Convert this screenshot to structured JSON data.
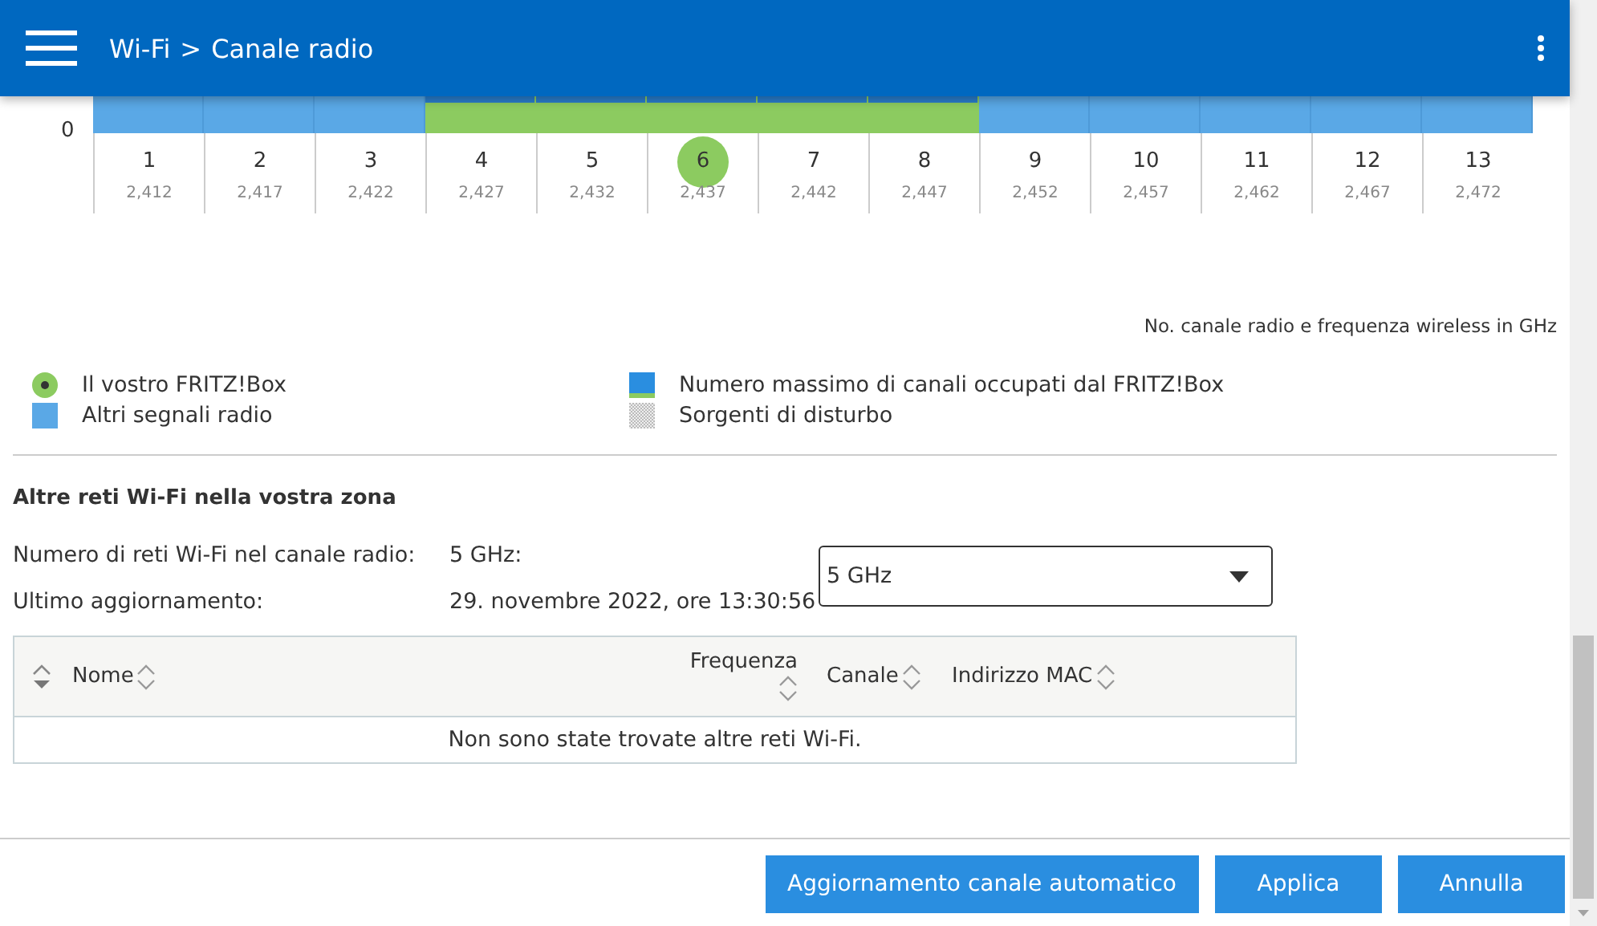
{
  "header": {
    "breadcrumb": [
      "Wi-Fi",
      "Canale radio"
    ],
    "separator": ">"
  },
  "chart": {
    "zero_label": "0",
    "channels": [
      {
        "number": "1",
        "frequency": "2,412",
        "occupied": false,
        "selected": false
      },
      {
        "number": "2",
        "frequency": "2,417",
        "occupied": false,
        "selected": false
      },
      {
        "number": "3",
        "frequency": "2,422",
        "occupied": false,
        "selected": false
      },
      {
        "number": "4",
        "frequency": "2,427",
        "occupied": true,
        "selected": false
      },
      {
        "number": "5",
        "frequency": "2,432",
        "occupied": true,
        "selected": false
      },
      {
        "number": "6",
        "frequency": "2,437",
        "occupied": true,
        "selected": true
      },
      {
        "number": "7",
        "frequency": "2,442",
        "occupied": true,
        "selected": false
      },
      {
        "number": "8",
        "frequency": "2,447",
        "occupied": true,
        "selected": false
      },
      {
        "number": "9",
        "frequency": "2,452",
        "occupied": false,
        "selected": false
      },
      {
        "number": "10",
        "frequency": "2,457",
        "occupied": false,
        "selected": false
      },
      {
        "number": "11",
        "frequency": "2,462",
        "occupied": false,
        "selected": false
      },
      {
        "number": "12",
        "frequency": "2,467",
        "occupied": false,
        "selected": false
      },
      {
        "number": "13",
        "frequency": "2,472",
        "occupied": false,
        "selected": false
      }
    ],
    "caption": "No. canale radio e frequenza wireless in GHz"
  },
  "legend": [
    {
      "kind": "own",
      "label": "Il vostro FRITZ!Box"
    },
    {
      "kind": "max",
      "label": "Numero massimo di canali occupati dal FRITZ!Box"
    },
    {
      "kind": "other",
      "label": "Altri segnali radio"
    },
    {
      "kind": "interference",
      "label": "Sorgenti di disturbo"
    }
  ],
  "networks": {
    "title": "Altre reti Wi-Fi nella vostra zona",
    "count_label": "Numero di reti Wi-Fi nel canale radio:",
    "count_value": "5 GHz:",
    "updated_label": "Ultimo aggiornamento:",
    "updated_value": "29. novembre 2022, ore 13:30:56",
    "band_select": "5 GHz",
    "columns": [
      "Nome",
      "Frequenza",
      "Canale",
      "Indirizzo MAC"
    ],
    "empty_message": "Non sono state trovate altre reti Wi-Fi."
  },
  "buttons": [
    "Aggiornamento canale automatico",
    "Applica",
    "Annulla"
  ]
}
